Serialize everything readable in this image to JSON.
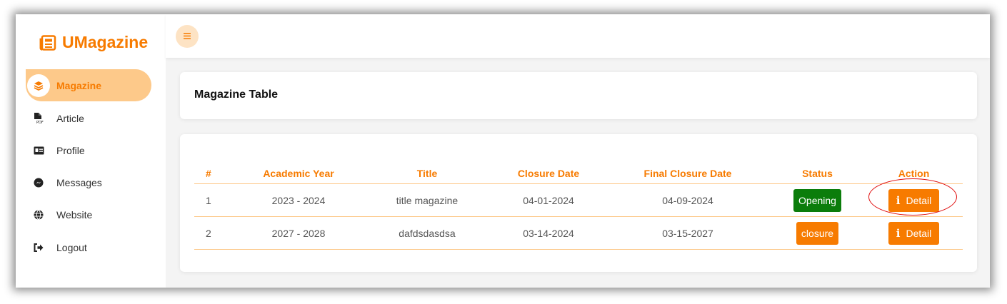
{
  "brand": {
    "name": "UMagazine",
    "icon": "newspaper-icon"
  },
  "sidebar": {
    "items": [
      {
        "label": "Magazine",
        "icon": "layers-icon",
        "active": true
      },
      {
        "label": "Article",
        "icon": "pdf-file-icon"
      },
      {
        "label": "Profile",
        "icon": "id-card-icon"
      },
      {
        "label": "Messages",
        "icon": "messenger-icon"
      },
      {
        "label": "Website",
        "icon": "globe-icon"
      },
      {
        "label": "Logout",
        "icon": "logout-icon"
      }
    ]
  },
  "header": {
    "menu_icon": "hamburger-icon"
  },
  "main": {
    "title": "Magazine Table",
    "table": {
      "columns": [
        "#",
        "Academic Year",
        "Title",
        "Closure Date",
        "Final Closure Date",
        "Status",
        "Action"
      ],
      "rows": [
        {
          "index": "1",
          "academic_year": "2023 - 2024",
          "title": "title magazine",
          "closure_date": "04-01-2024",
          "final_closure_date": "04-09-2024",
          "status": "Opening",
          "action": "Detail"
        },
        {
          "index": "2",
          "academic_year": "2027 - 2028",
          "title": "dafdsdasdsa",
          "closure_date": "03-14-2024",
          "final_closure_date": "03-15-2027",
          "status": "closure",
          "action": "Detail"
        }
      ]
    }
  },
  "colors": {
    "accent": "#f77b00",
    "accent_light": "#fdc98a",
    "status_open": "#0b7d0b",
    "annotation_ring": "#e01010"
  }
}
